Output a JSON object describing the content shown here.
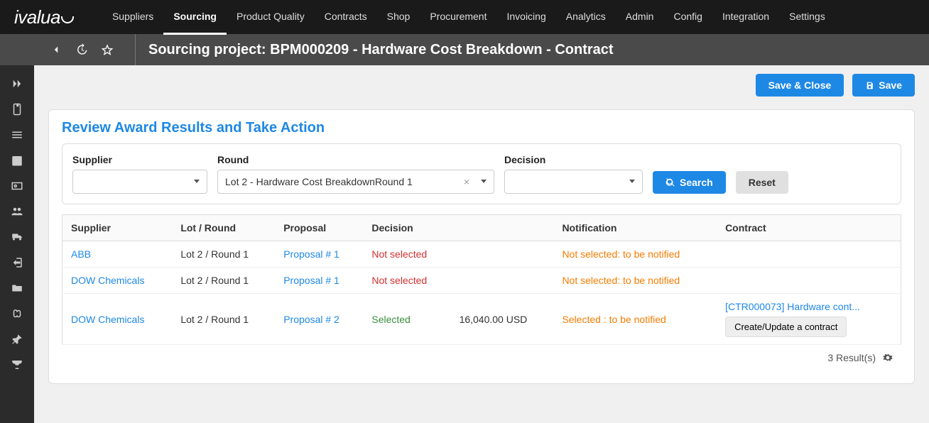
{
  "brand": "ivalua",
  "nav": [
    "Suppliers",
    "Sourcing",
    "Product Quality",
    "Contracts",
    "Shop",
    "Procurement",
    "Invoicing",
    "Analytics",
    "Admin",
    "Config",
    "Integration",
    "Settings"
  ],
  "nav_active": "Sourcing",
  "page_title": "Sourcing project: BPM000209 - Hardware Cost Breakdown - Contract",
  "actions": {
    "save_close": "Save & Close",
    "save": "Save"
  },
  "section_title": "Review Award Results and Take Action",
  "filters": {
    "supplier_label": "Supplier",
    "supplier_value": "",
    "round_label": "Round",
    "round_value": "Lot 2 - Hardware Cost BreakdownRound 1",
    "decision_label": "Decision",
    "decision_value": "",
    "search": "Search",
    "reset": "Reset"
  },
  "table": {
    "headers": [
      "Supplier",
      "Lot / Round",
      "Proposal",
      "Decision",
      "",
      "Notification",
      "Contract"
    ],
    "rows": [
      {
        "supplier": "ABB",
        "lot": "Lot 2 / Round 1",
        "proposal": "Proposal # 1",
        "decision": "Not selected",
        "decision_class": "red",
        "amount": "",
        "notif": "Not selected: to be notified",
        "notif_class": "orange",
        "contract_link": "",
        "contract_btn": ""
      },
      {
        "supplier": "DOW Chemicals",
        "lot": "Lot 2 / Round 1",
        "proposal": "Proposal # 1",
        "decision": "Not selected",
        "decision_class": "red",
        "amount": "",
        "notif": "Not selected: to be notified",
        "notif_class": "orange",
        "contract_link": "",
        "contract_btn": ""
      },
      {
        "supplier": "DOW Chemicals",
        "lot": "Lot 2 / Round 1",
        "proposal": "Proposal # 2",
        "decision": "Selected",
        "decision_class": "green",
        "amount": "16,040.00 USD",
        "notif": "Selected : to be notified",
        "notif_class": "orange",
        "contract_link": "[CTR000073] Hardware cont...",
        "contract_btn": "Create/Update a contract"
      }
    ],
    "result_text": "3  Result(s)"
  }
}
